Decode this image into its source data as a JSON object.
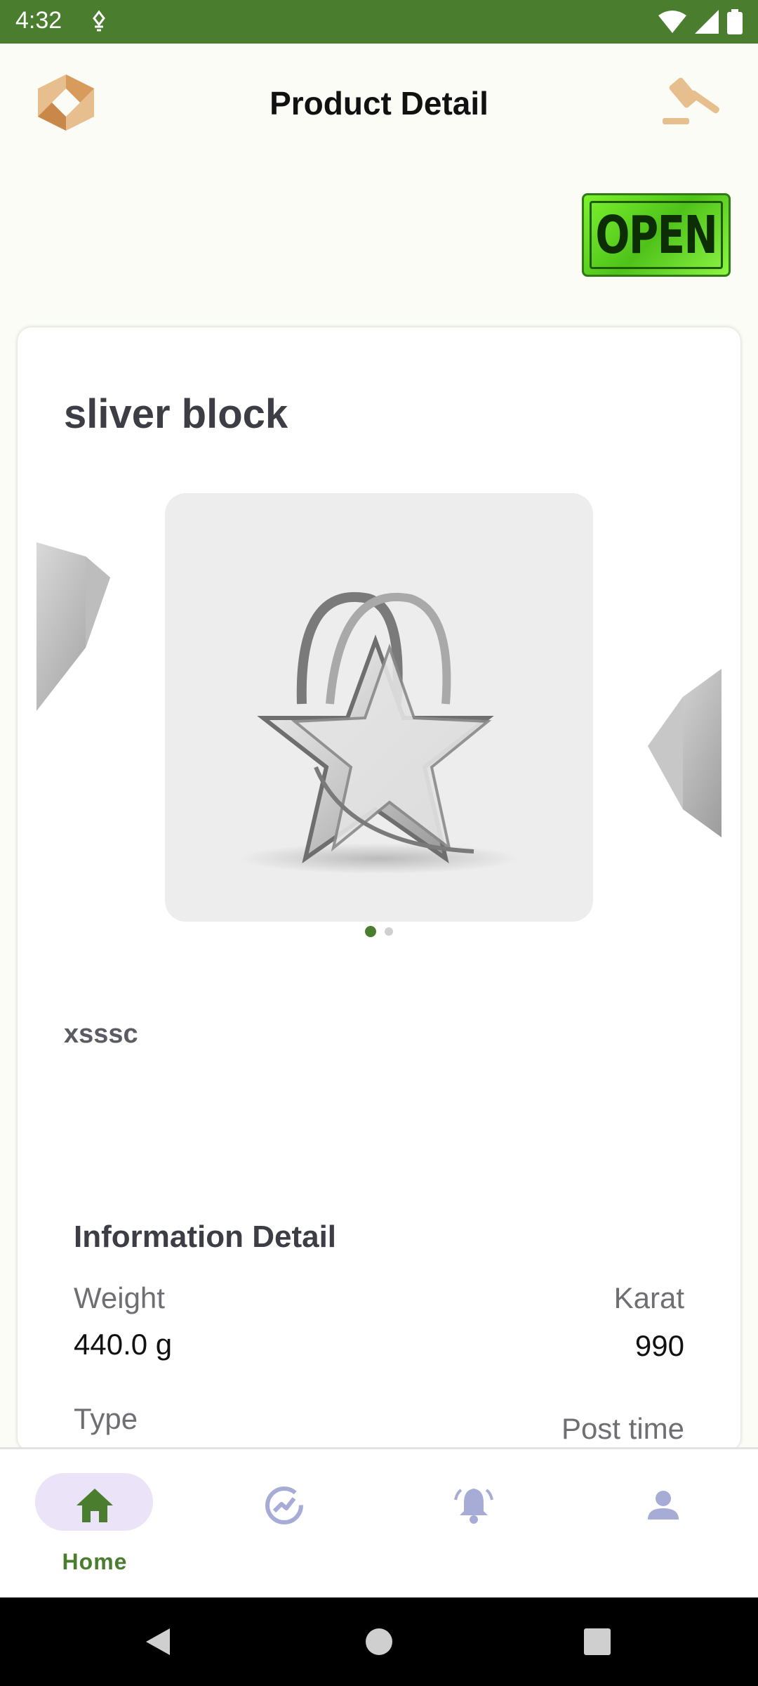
{
  "status_bar": {
    "time": "4:32"
  },
  "header": {
    "title": "Product Detail"
  },
  "badge": {
    "text": "OPEN"
  },
  "product": {
    "name": "sliver block",
    "description": "xsssc",
    "carousel": {
      "total_slides": 2,
      "active_index": 0
    }
  },
  "info": {
    "title": "Information Detail",
    "weight_label": "Weight",
    "weight_value": "440.0 g",
    "karat_label": "Karat",
    "karat_value": "990",
    "type_label": "Type",
    "post_time_label": "Post time"
  },
  "bottom_nav": {
    "items": [
      {
        "label": "Home",
        "icon": "home-icon",
        "active": true
      },
      {
        "label": "",
        "icon": "trend-icon",
        "active": false
      },
      {
        "label": "",
        "icon": "bell-icon",
        "active": false
      },
      {
        "label": "",
        "icon": "person-icon",
        "active": false
      }
    ]
  },
  "colors": {
    "status_bar": "#4a7d2e",
    "accent_green": "#4a7d2e",
    "nav_pill": "#ebe3f7",
    "nav_icon_inactive": "#a7acd6",
    "logo_orange": "#d9a36a",
    "background": "#fbfcf6"
  }
}
